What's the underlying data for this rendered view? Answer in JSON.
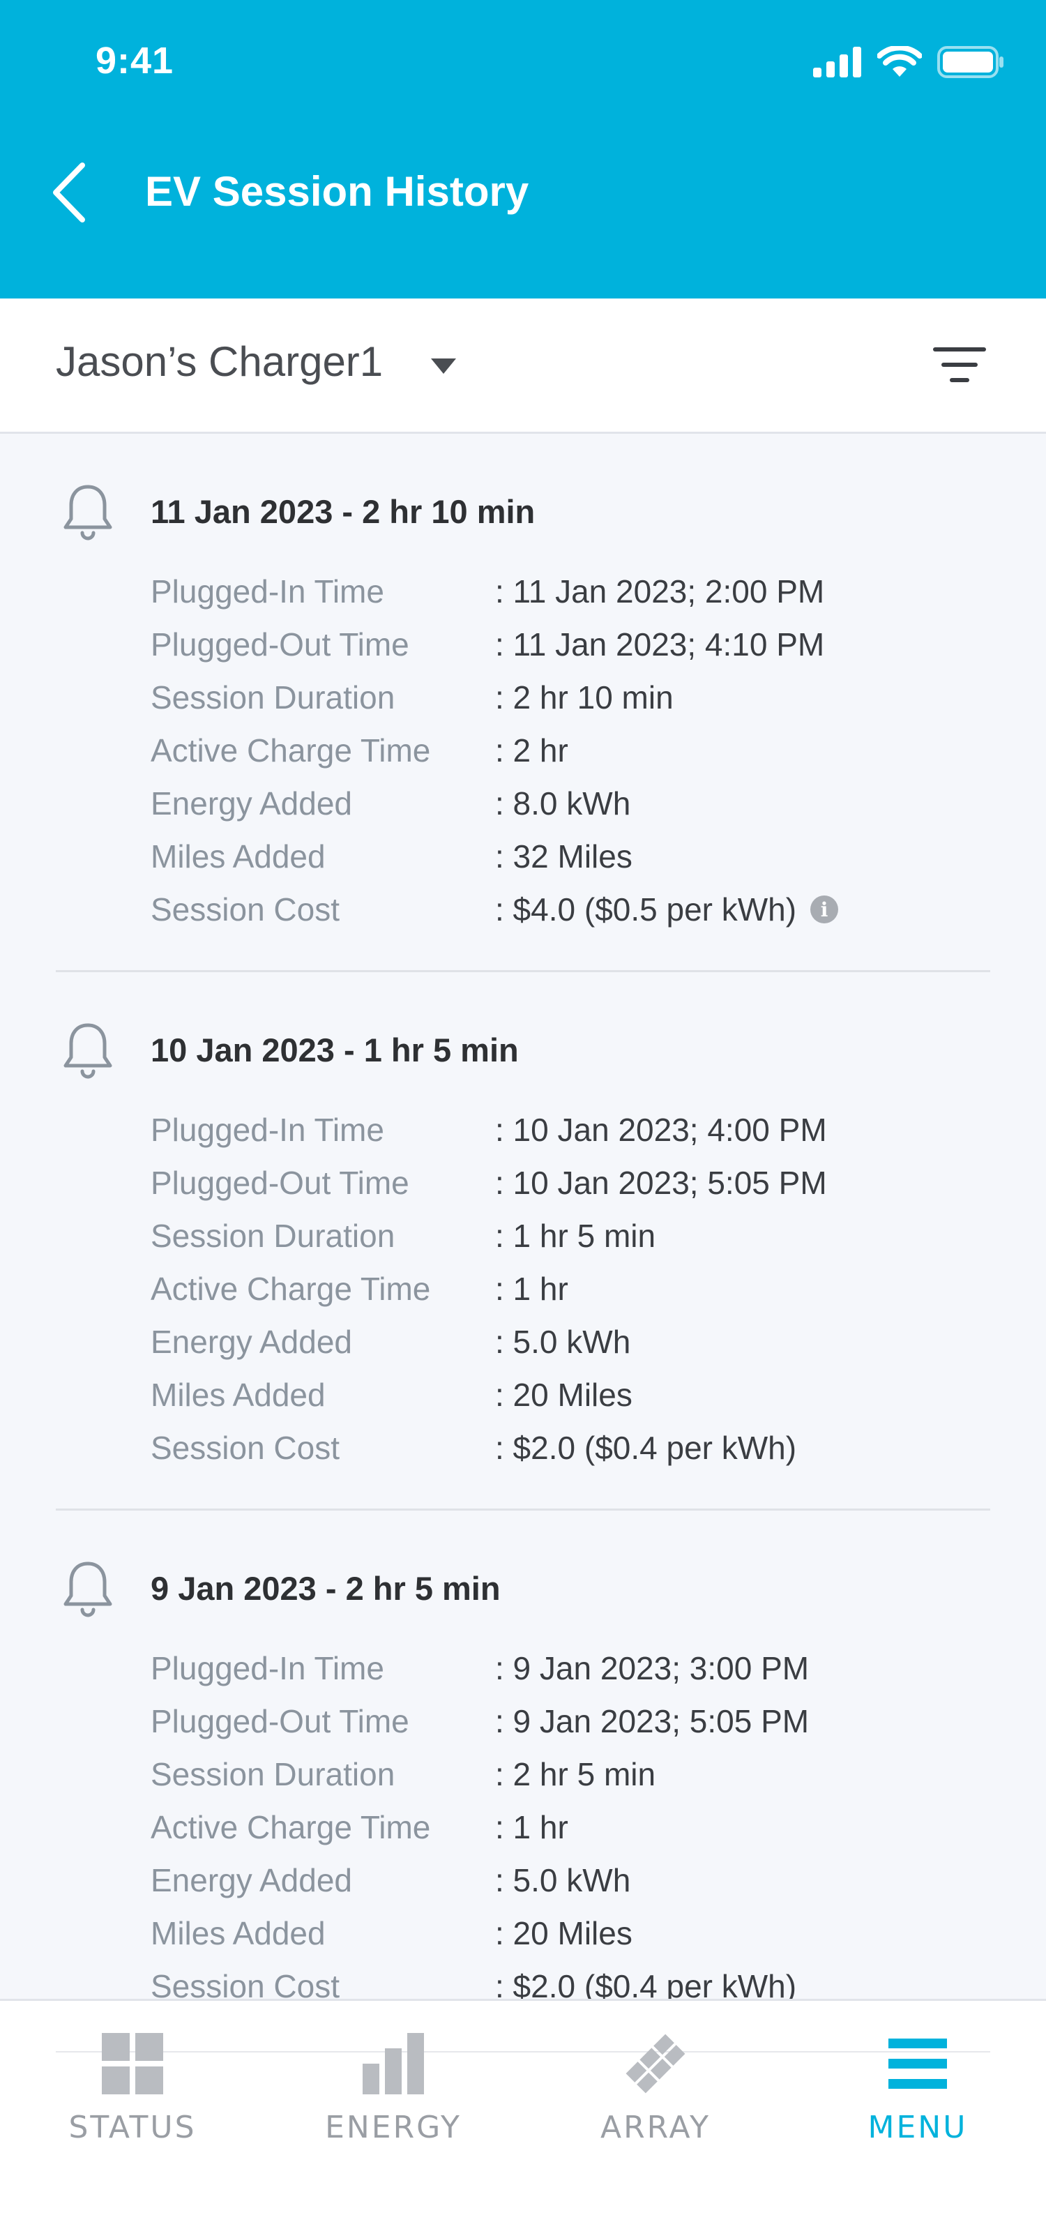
{
  "status_bar": {
    "time": "9:41"
  },
  "header": {
    "title": "EV Session History"
  },
  "selector": {
    "charger_name": "Jason’s Charger1"
  },
  "sessions": [
    {
      "heading": "11 Jan 2023 - 2 hr 10 min",
      "rows": [
        {
          "label": "Plugged-In Time",
          "value": ": 11 Jan 2023; 2:00 PM"
        },
        {
          "label": "Plugged-Out Time",
          "value": ": 11 Jan 2023; 4:10 PM"
        },
        {
          "label": "Session Duration",
          "value": ": 2 hr 10 min"
        },
        {
          "label": "Active Charge Time",
          "value": ": 2 hr"
        },
        {
          "label": "Energy Added",
          "value": ": 8.0 kWh"
        },
        {
          "label": "Miles Added",
          "value": ": 32 Miles"
        },
        {
          "label": "Session Cost",
          "value": ": $4.0 ($0.5 per kWh)"
        }
      ]
    },
    {
      "heading": "10 Jan 2023 - 1 hr 5 min",
      "rows": [
        {
          "label": "Plugged-In Time",
          "value": ": 10 Jan 2023; 4:00 PM"
        },
        {
          "label": "Plugged-Out Time",
          "value": ": 10 Jan 2023; 5:05 PM"
        },
        {
          "label": "Session Duration",
          "value": ": 1 hr 5 min"
        },
        {
          "label": "Active Charge Time",
          "value": ": 1 hr"
        },
        {
          "label": "Energy Added",
          "value": ": 5.0 kWh"
        },
        {
          "label": "Miles Added",
          "value": ": 20 Miles"
        },
        {
          "label": "Session Cost",
          "value": ": $2.0 ($0.4 per kWh)"
        }
      ]
    },
    {
      "heading": "9 Jan 2023 - 2 hr 5 min",
      "rows": [
        {
          "label": "Plugged-In Time",
          "value": ": 9 Jan 2023; 3:00 PM"
        },
        {
          "label": "Plugged-Out Time",
          "value": ": 9 Jan 2023; 5:05 PM"
        },
        {
          "label": "Session Duration",
          "value": ": 2 hr 5 min"
        },
        {
          "label": "Active Charge Time",
          "value": ": 1 hr"
        },
        {
          "label": "Energy Added",
          "value": ": 5.0 kWh"
        },
        {
          "label": "Miles Added",
          "value": ": 20 Miles"
        },
        {
          "label": "Session Cost",
          "value": ": $2.0 ($0.4 per kWh)"
        }
      ]
    }
  ],
  "nav": {
    "status": "STATUS",
    "energy": "ENERGY",
    "array": "ARRAY",
    "menu": "MENU"
  },
  "colors": {
    "accent": "#00b2dc",
    "inactive": "#9a9ea4"
  }
}
